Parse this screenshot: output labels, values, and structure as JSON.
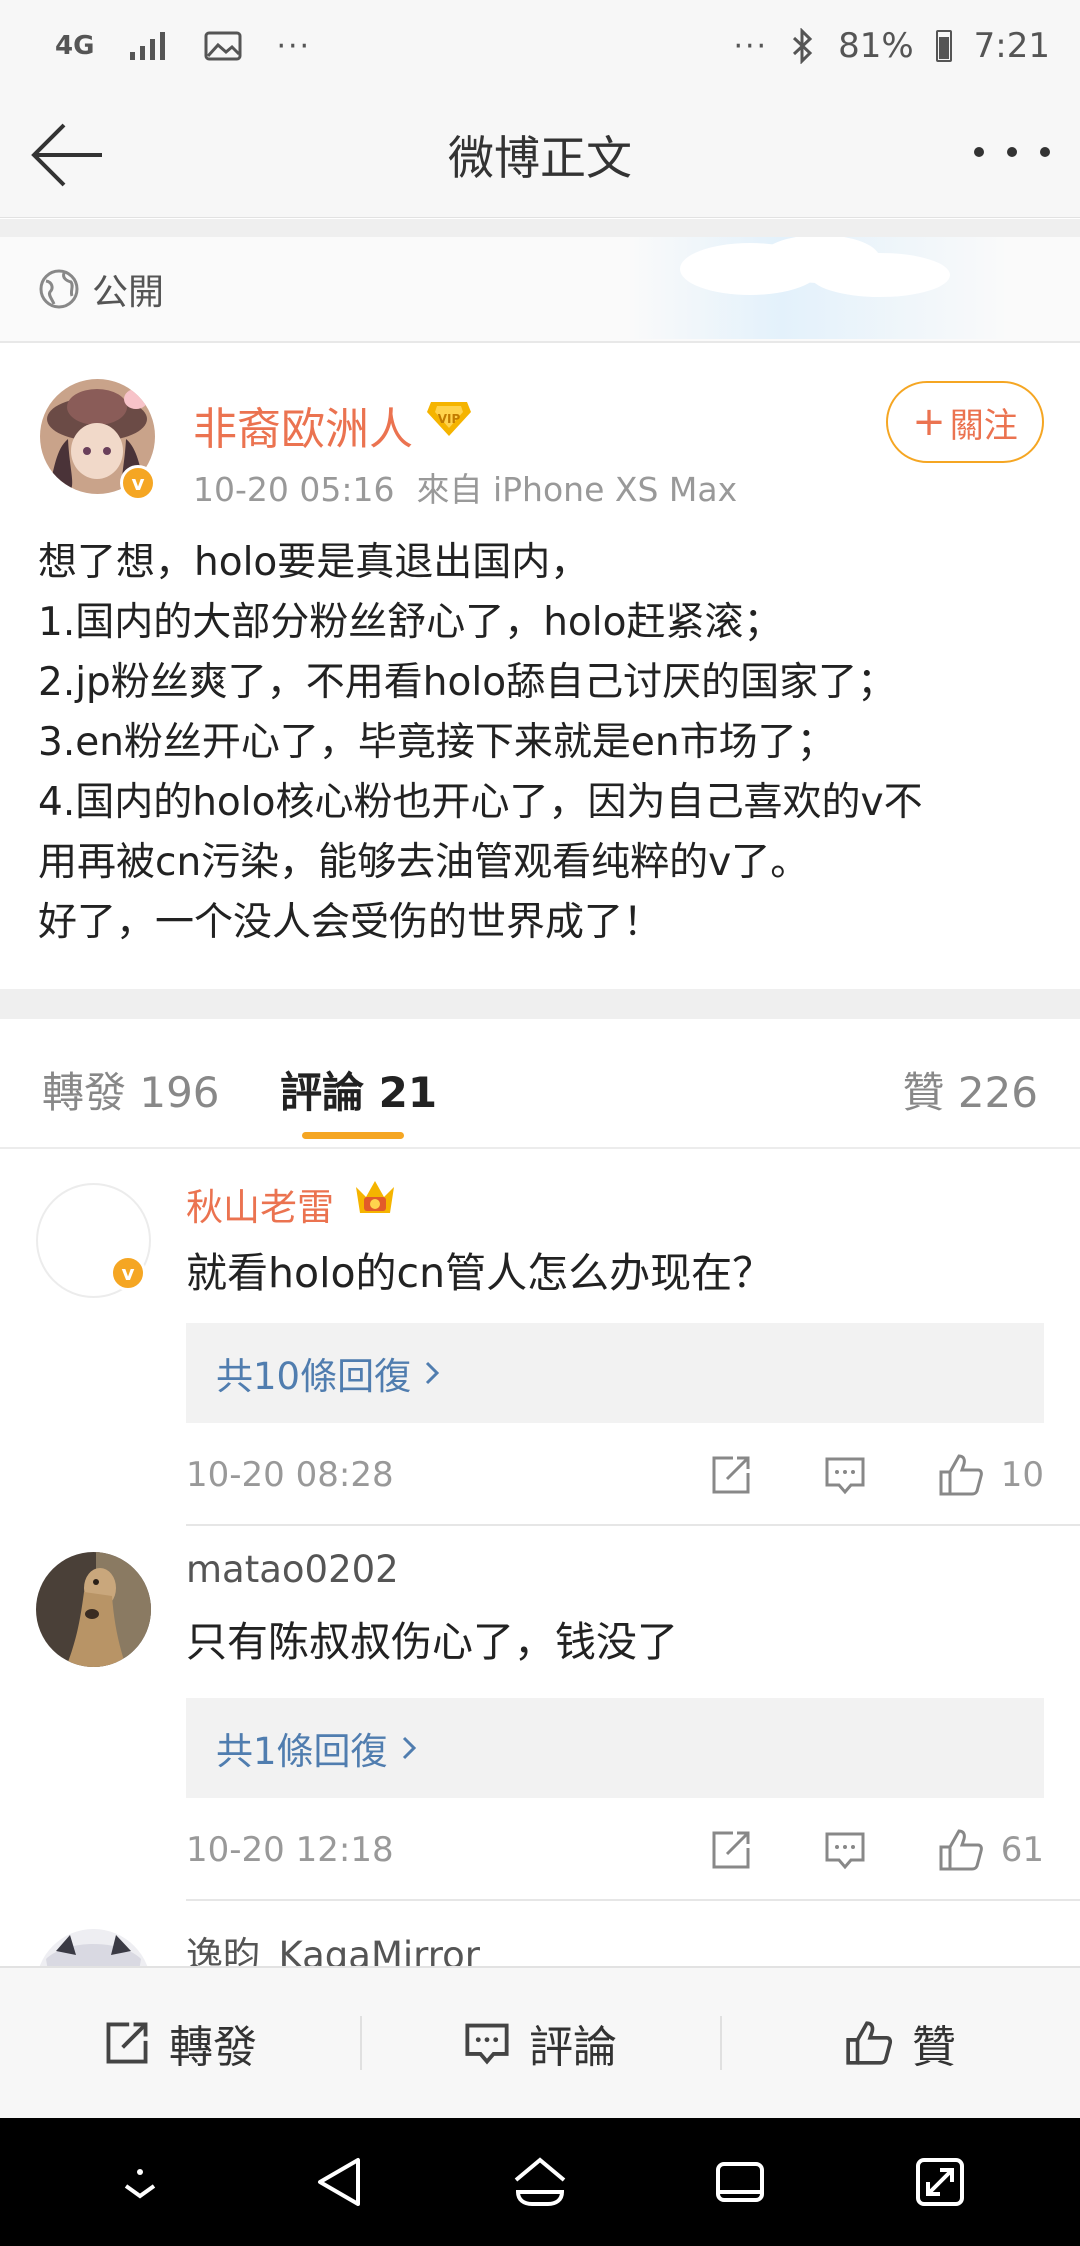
{
  "status_bar": {
    "network": "4G",
    "battery": "81%",
    "time": "7:21",
    "overflow": "···"
  },
  "nav": {
    "title": "微博正文"
  },
  "visibility": {
    "label": "公開"
  },
  "post": {
    "author": "非裔欧洲人",
    "verified_mark": "v",
    "date": "10-20 05:16",
    "source": "來自 iPhone XS Max",
    "follow_label": "關注",
    "follow_plus": "+",
    "lines": [
      "想了想，holo要是真退出国内，",
      "1.国内的大部分粉丝舒心了，holo赶紧滚；",
      "2.jp粉丝爽了，不用看holo舔自己讨厌的国家了；",
      "3.en粉丝开心了，毕竟接下来就是en市场了；",
      "4.国内的holo核心粉也开心了，因为自己喜欢的v不",
      "用再被cn污染，能够去油管观看纯粹的v了。",
      "好了，一个没人会受伤的世界成了！"
    ]
  },
  "tabs": {
    "repost": "轉發 196",
    "comments": "評論 21",
    "likes": "贊 226"
  },
  "comments": [
    {
      "name": "秋山老雷",
      "text": "就看holo的cn管人怎么办现在？",
      "replies": "共10條回復",
      "time": "10-20 08:28",
      "likes": "10"
    },
    {
      "name": "matao0202",
      "text": "只有陈叔叔伤心了，钱没了",
      "replies": "共1條回復",
      "time": "10-20 12:18",
      "likes": "61"
    },
    {
      "name": "逸昀_KagaMirror"
    }
  ],
  "bottom_bar": {
    "repost": "轉發",
    "comment": "評論",
    "like": "贊"
  },
  "colors": {
    "accent_orange": "#f5a623",
    "name_orange": "#eb7350",
    "link_blue": "#507daf"
  },
  "icons": [
    "back-arrow-icon",
    "more-icon",
    "globe-icon",
    "vip-icon",
    "crown-icon",
    "share-icon",
    "comment-icon",
    "like-icon",
    "chevron-right-icon"
  ]
}
